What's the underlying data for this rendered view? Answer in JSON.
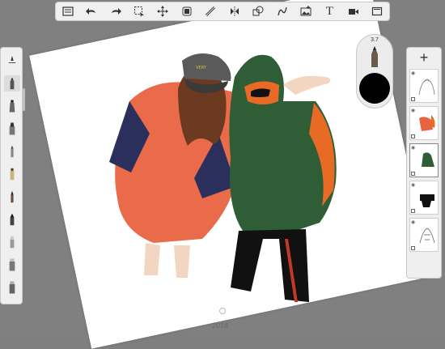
{
  "toolbar": {
    "items": [
      {
        "name": "gallery-icon"
      },
      {
        "name": "undo-icon"
      },
      {
        "name": "redo-icon"
      },
      {
        "name": "select-icon"
      },
      {
        "name": "transform-icon"
      },
      {
        "name": "layer-copy-icon"
      },
      {
        "name": "ruler-icon"
      },
      {
        "name": "symmetry-icon"
      },
      {
        "name": "shape-icon"
      },
      {
        "name": "curve-icon"
      },
      {
        "name": "image-icon"
      },
      {
        "name": "text-tool",
        "label": "T"
      },
      {
        "name": "video-icon"
      },
      {
        "name": "fullscreen-icon"
      }
    ]
  },
  "brush_panel": {
    "brushes": [
      {
        "name": "brush-settings-icon"
      },
      {
        "name": "brush-pencil",
        "selected": true
      },
      {
        "name": "brush-marker"
      },
      {
        "name": "brush-ink"
      },
      {
        "name": "brush-paint"
      },
      {
        "name": "brush-airbrush"
      },
      {
        "name": "brush-pen"
      },
      {
        "name": "brush-fill"
      },
      {
        "name": "brush-eraser"
      },
      {
        "name": "brush-blur"
      },
      {
        "name": "brush-smudge"
      }
    ]
  },
  "puck": {
    "size_label": "3.7",
    "color": "#000000"
  },
  "layers": {
    "add_label": "+",
    "items": [
      {
        "name": "layer-1-sketch"
      },
      {
        "name": "layer-2-orange",
        "selected": false
      },
      {
        "name": "layer-3-green"
      },
      {
        "name": "layer-4-black"
      },
      {
        "name": "layer-5-lines"
      }
    ]
  },
  "canvas": {
    "signature": "2018"
  },
  "colors": {
    "orange": "#e8633f",
    "green": "#2f5e36",
    "black": "#111111"
  }
}
